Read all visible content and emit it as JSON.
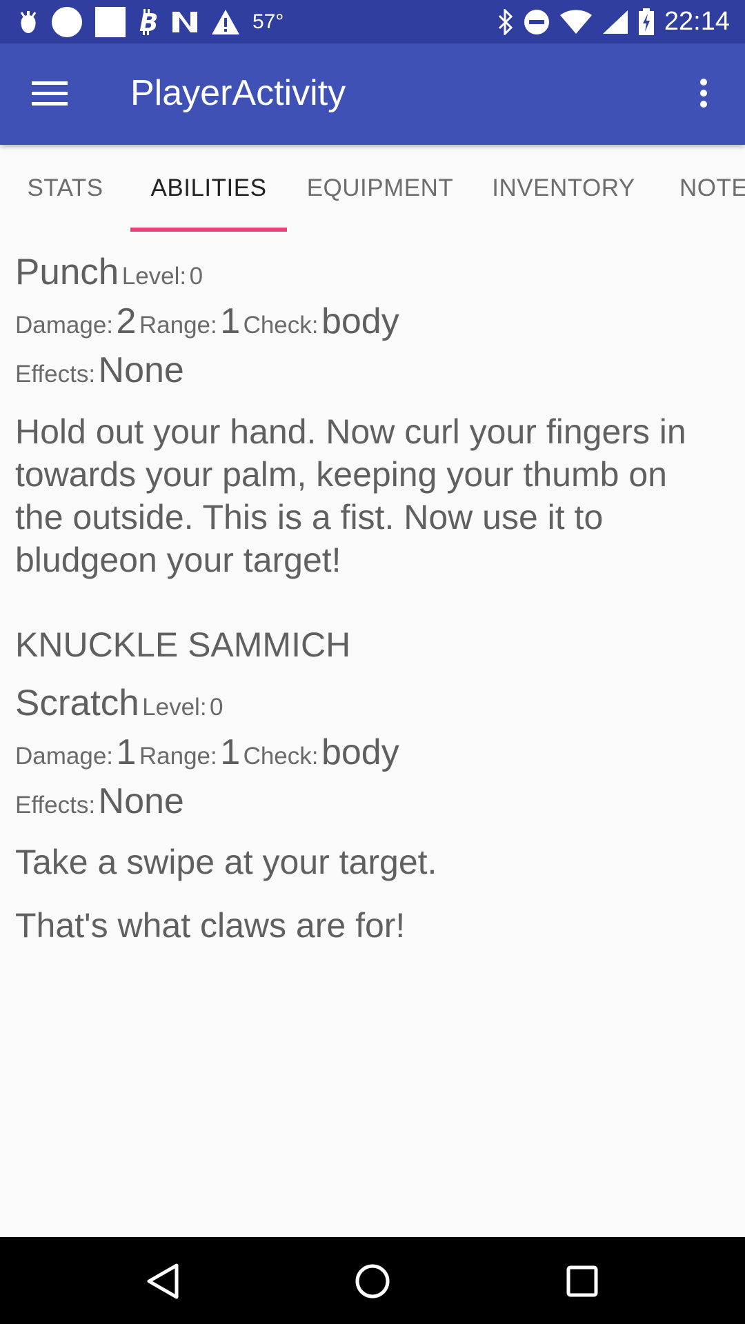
{
  "status_bar": {
    "temperature": "57°",
    "time": "22:14",
    "left_icons": [
      "bell-pepper-icon",
      "circle-icon",
      "square-icon",
      "bitcoin-icon",
      "n-logo-icon",
      "warning-icon"
    ],
    "right_icons": [
      "bluetooth-icon",
      "do-not-disturb-icon",
      "wifi-icon",
      "signal-icon",
      "battery-icon"
    ]
  },
  "app_bar": {
    "title": "PlayerActivity"
  },
  "tabs": [
    {
      "label": "STATS"
    },
    {
      "label": "ABILITIES"
    },
    {
      "label": "EQUIPMENT"
    },
    {
      "label": "INVENTORY"
    },
    {
      "label": "NOTE"
    }
  ],
  "active_tab": "ABILITIES",
  "labels": {
    "level": "Level:",
    "damage": "Damage:",
    "range": "Range:",
    "check": "Check:",
    "effects": "Effects:"
  },
  "abilities": [
    {
      "name": "Punch",
      "level": "0",
      "damage": "2",
      "range": "1",
      "check": "body",
      "effects": "None",
      "description": "Hold out your hand. Now curl your fingers in towards your palm, keeping your thumb on the outside. This is a fist. Now use it to bludgeon your target!",
      "flavor": "KNUCKLE SAMMICH"
    },
    {
      "name": "Scratch",
      "level": "0",
      "damage": "1",
      "range": "1",
      "check": "body",
      "effects": "None",
      "description": "Take a swipe at your target.",
      "flavor": "That's what claws are for!"
    }
  ],
  "colors": {
    "status_bar": "#303f9f",
    "app_bar": "#3f51b5",
    "tab_indicator": "#ec407a",
    "background": "#fafafa"
  }
}
